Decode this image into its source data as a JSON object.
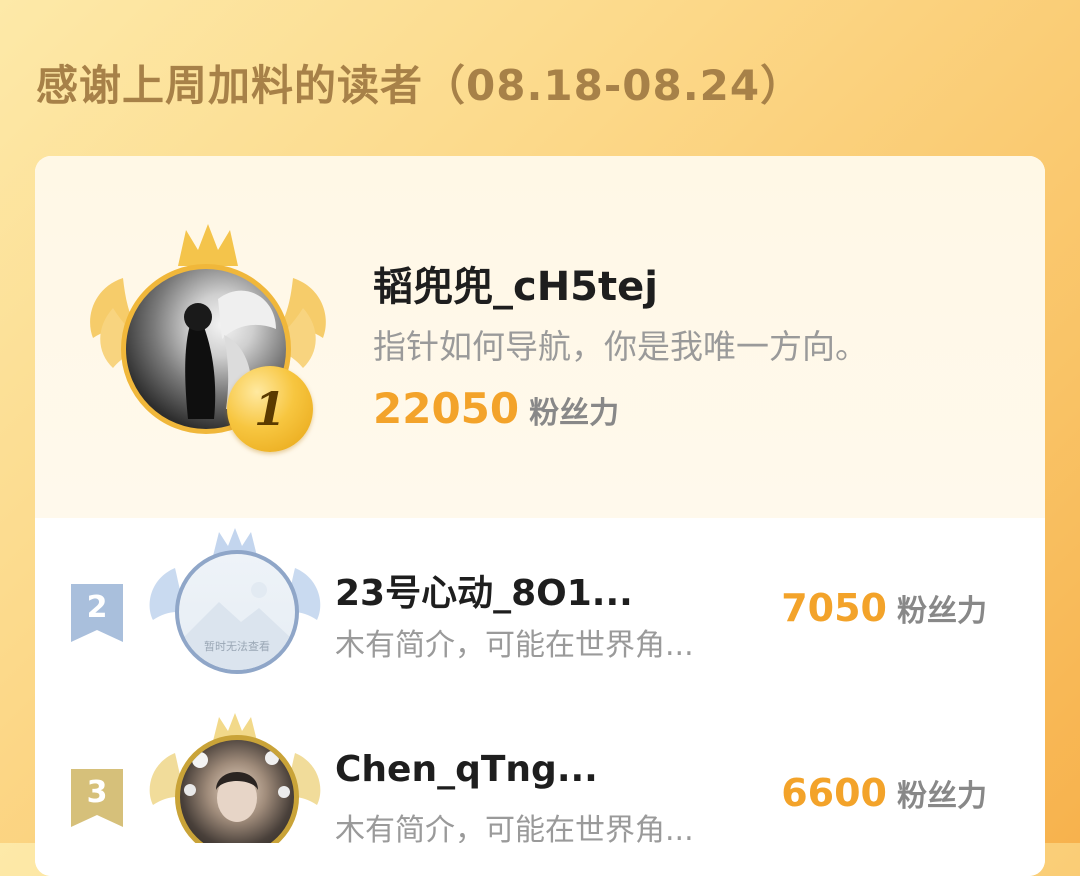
{
  "header": {
    "title": "感谢上周加料的读者（08.18-08.24）"
  },
  "leaderboard": {
    "score_unit": "粉丝力",
    "first": {
      "rank": "1",
      "name": "韬兜兜_cH5tej",
      "bio": "指针如何导航，你是我唯一方向。",
      "score": "22050"
    },
    "rows": [
      {
        "rank": "2",
        "name": "23号心动_8O1...",
        "bio": "木有简介，可能在世界角...",
        "score": "7050",
        "avatar_placeholder": "暂时无法查看"
      },
      {
        "rank": "3",
        "name": "Chen_qTng...",
        "bio": "木有简介，可能在世界角...",
        "score": "6600"
      }
    ]
  },
  "colors": {
    "gold": "#f3a32a",
    "silver": "#8fa6c8",
    "bronze": "#c9a338",
    "title": "#a78148"
  },
  "icons": {
    "crown": "crown-icon",
    "wings": "wings-icon",
    "rank_flag": "rank-flag-icon"
  }
}
